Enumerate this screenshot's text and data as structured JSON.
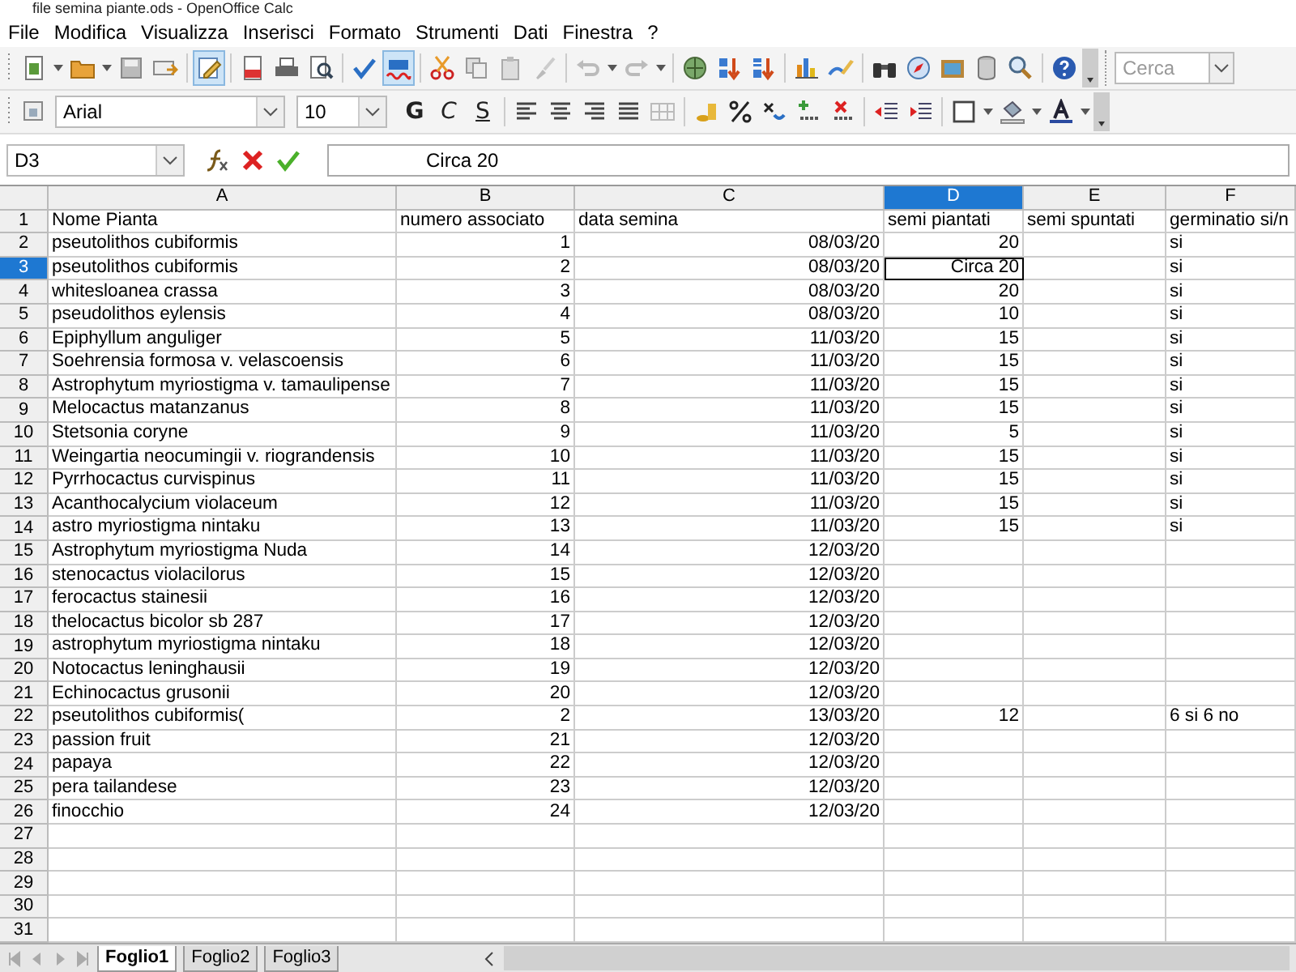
{
  "window": {
    "title": "file semina piante.ods - OpenOffice Calc"
  },
  "menu": [
    "File",
    "Modifica",
    "Visualizza",
    "Inserisci",
    "Formato",
    "Strumenti",
    "Dati",
    "Finestra",
    "?"
  ],
  "toolbar": {
    "edit_mode": {
      "on": true
    },
    "auto_spellcheck": {
      "on": true
    },
    "search": {
      "placeholder": "Cerca"
    }
  },
  "format_bar": {
    "font": "Arial",
    "size": "10",
    "bold": "G",
    "italic": "C",
    "underline": "S"
  },
  "formula_bar": {
    "name_box": "D3",
    "formula": "Circa 20"
  },
  "sheet": {
    "columns": [
      {
        "label": "A",
        "selected": false
      },
      {
        "label": "B",
        "selected": false
      },
      {
        "label": "C",
        "selected": false
      },
      {
        "label": "D",
        "selected": true
      },
      {
        "label": "E",
        "selected": false
      },
      {
        "label": "F",
        "selected": false
      }
    ],
    "rows": [
      {
        "number": "1",
        "selected": false,
        "A": "Nome Pianta",
        "B": "numero associato",
        "C": "data semina",
        "D": "semi piantati",
        "E": "semi spuntati",
        "F": "germinatio si/n"
      },
      {
        "number": "2",
        "selected": false,
        "A": "pseutolithos cubiformis",
        "B": "1",
        "C": "08/03/20",
        "D": "20",
        "F": "si"
      },
      {
        "number": "3",
        "selected": true,
        "A": "pseutolithos cubiformis",
        "B": "2",
        "C": "08/03/20",
        "D": "Circa 20",
        "F": "si"
      },
      {
        "number": "4",
        "selected": false,
        "A": "whitesloanea crassa",
        "B": "3",
        "C": "08/03/20",
        "D": "20",
        "F": "si"
      },
      {
        "number": "5",
        "selected": false,
        "A": "pseudolithos eylensis",
        "B": "4",
        "C": "08/03/20",
        "D": "10",
        "F": "si"
      },
      {
        "number": "6",
        "selected": false,
        "A": "Epiphyllum anguliger",
        "B": "5",
        "C": "11/03/20",
        "D": "15",
        "F": "si"
      },
      {
        "number": "7",
        "selected": false,
        "A": "Soehrensia formosa v. velascoensis",
        "B": "6",
        "C": "11/03/20",
        "D": "15",
        "F": "si"
      },
      {
        "number": "8",
        "selected": false,
        "A": "Astrophytum myriostigma v. tamaulipense",
        "B": "7",
        "C": "11/03/20",
        "D": "15",
        "F": "si"
      },
      {
        "number": "9",
        "selected": false,
        "A": "Melocactus matanzanus",
        "B": "8",
        "C": "11/03/20",
        "D": "15",
        "F": "si"
      },
      {
        "number": "10",
        "selected": false,
        "A": "Stetsonia coryne",
        "B": "9",
        "C": "11/03/20",
        "D": "5",
        "F": "si"
      },
      {
        "number": "11",
        "selected": false,
        "A": "Weingartia neocumingii v. riograndensis",
        "B": "10",
        "C": "11/03/20",
        "D": "15",
        "F": "si"
      },
      {
        "number": "12",
        "selected": false,
        "A": "Pyrrhocactus curvispinus",
        "B": "11",
        "C": "11/03/20",
        "D": "15",
        "F": "si"
      },
      {
        "number": "13",
        "selected": false,
        "A": "Acanthocalycium violaceum",
        "B": "12",
        "C": "11/03/20",
        "D": "15",
        "F": "si"
      },
      {
        "number": "14",
        "selected": false,
        "A": "astro myriostigma nintaku",
        "B": "13",
        "C": "11/03/20",
        "D": "15",
        "F": "si"
      },
      {
        "number": "15",
        "selected": false,
        "A": "Astrophytum myriostigma Nuda",
        "B": "14",
        "C": "12/03/20"
      },
      {
        "number": "16",
        "selected": false,
        "A": "stenocactus violacilorus",
        "B": "15",
        "C": "12/03/20"
      },
      {
        "number": "17",
        "selected": false,
        "A": "ferocactus stainesii",
        "B": "16",
        "C": "12/03/20"
      },
      {
        "number": "18",
        "selected": false,
        "A": "thelocactus bicolor sb 287",
        "B": "17",
        "C": "12/03/20"
      },
      {
        "number": "19",
        "selected": false,
        "A": "astrophytum myriostigma nintaku",
        "B": "18",
        "C": "12/03/20"
      },
      {
        "number": "20",
        "selected": false,
        "A": "Notocactus leninghausii",
        "B": "19",
        "C": "12/03/20"
      },
      {
        "number": "21",
        "selected": false,
        "A": "Echinocactus grusonii",
        "B": "20",
        "C": "12/03/20"
      },
      {
        "number": "22",
        "selected": false,
        "A": "pseutolithos cubiformis(",
        "B": "2",
        "C": "13/03/20",
        "D": "12",
        "F": "6 si 6 no"
      },
      {
        "number": "23",
        "selected": false,
        "A": "passion fruit",
        "B": "21",
        "C": "12/03/20"
      },
      {
        "number": "24",
        "selected": false,
        "A": "papaya",
        "B": "22",
        "C": "12/03/20"
      },
      {
        "number": "25",
        "selected": false,
        "A": "pera tailandese",
        "B": "23",
        "C": "12/03/20"
      },
      {
        "number": "26",
        "selected": false,
        "A": "finocchio",
        "B": "24",
        "C": "12/03/20"
      },
      {
        "number": "27",
        "selected": false
      },
      {
        "number": "28",
        "selected": false
      },
      {
        "number": "29",
        "selected": false
      },
      {
        "number": "30",
        "selected": false
      },
      {
        "number": "31",
        "selected": false
      }
    ]
  },
  "sheet_tabs": [
    {
      "label": "Foglio1",
      "selected": true
    },
    {
      "label": "Foglio2",
      "selected": false
    },
    {
      "label": "Foglio3",
      "selected": false
    }
  ]
}
